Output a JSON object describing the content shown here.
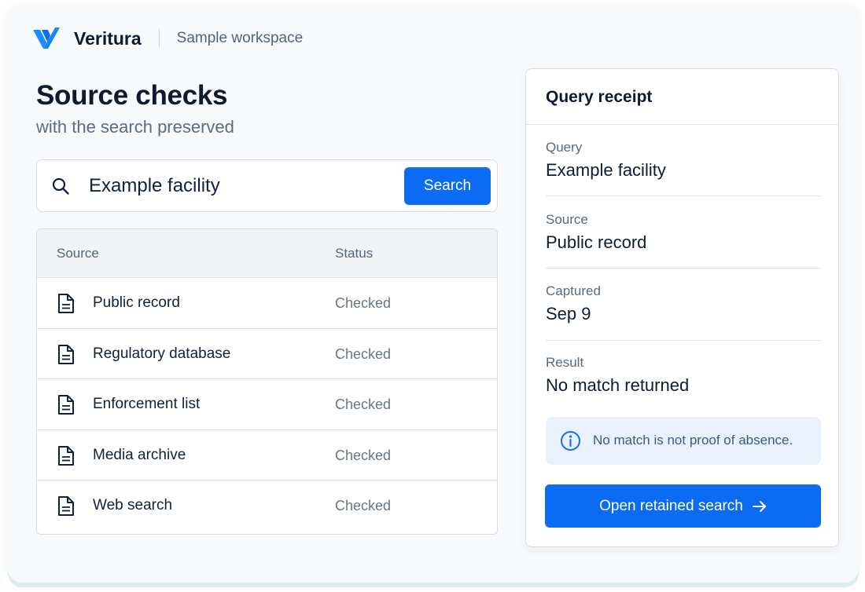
{
  "header": {
    "brand_name": "Veritura",
    "workspace": "Sample workspace"
  },
  "page": {
    "title": "Source checks",
    "subtitle": "with the search preserved"
  },
  "search": {
    "value": "Example facility",
    "button_label": "Search",
    "icon": "search-icon"
  },
  "sources_table": {
    "columns": [
      "Source",
      "Status"
    ],
    "rows": [
      {
        "source": "Public record",
        "status": "Checked",
        "icon": "document-icon"
      },
      {
        "source": "Regulatory database",
        "status": "Checked",
        "icon": "document-icon"
      },
      {
        "source": "Enforcement list",
        "status": "Checked",
        "icon": "document-icon"
      },
      {
        "source": "Media archive",
        "status": "Checked",
        "icon": "document-icon"
      },
      {
        "source": "Web search",
        "status": "Checked",
        "icon": "document-icon"
      }
    ]
  },
  "receipt": {
    "title": "Query receipt",
    "fields": [
      {
        "label": "Query",
        "value": "Example facility"
      },
      {
        "label": "Source",
        "value": "Public record"
      },
      {
        "label": "Captured",
        "value": "Sep 9"
      },
      {
        "label": "Result",
        "value": "No match returned"
      }
    ],
    "notice": "No match is not proof of absence.",
    "notice_icon": "info-icon",
    "button_label": "Open retained search",
    "button_icon": "arrow-right-icon"
  },
  "colors": {
    "accent": "#0b6cf3",
    "notice_bg": "#e9f2fc",
    "text_primary": "#0f1b31",
    "text_muted": "#6b7587"
  }
}
